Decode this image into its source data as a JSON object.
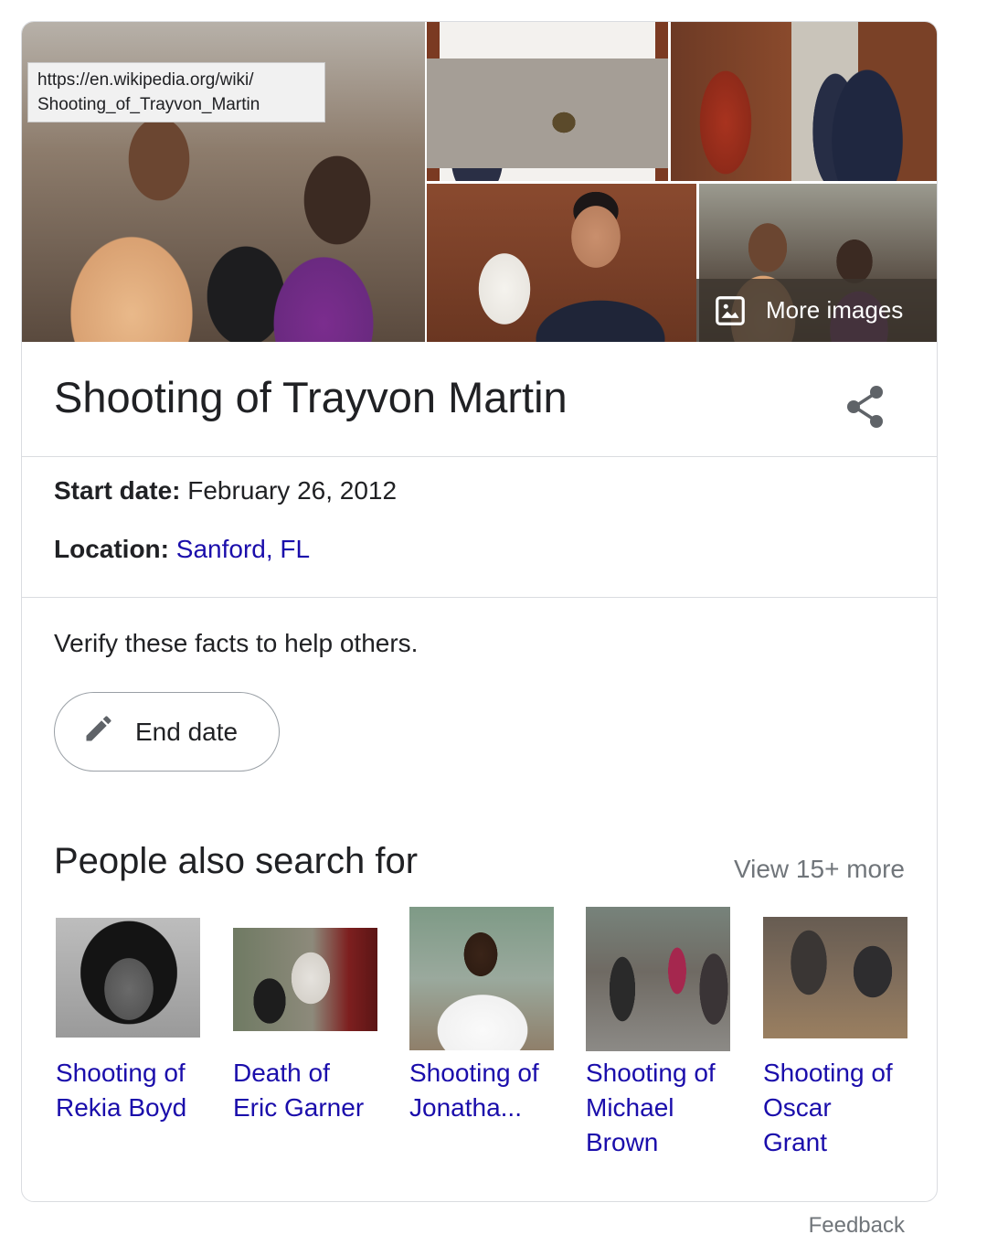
{
  "tooltip": {
    "line1": "https://en.wikipedia.org/wiki/",
    "line2": "Shooting_of_Trayvon_Martin"
  },
  "images": {
    "more_images_label": "More images"
  },
  "header": {
    "title": "Shooting of Trayvon Martin",
    "share_icon": "share-icon"
  },
  "facts": [
    {
      "label": "Start date:",
      "value": "February 26, 2012",
      "is_link": false
    },
    {
      "label": "Location:",
      "value": "Sanford, FL",
      "is_link": true
    }
  ],
  "verify": {
    "text": "Verify these facts to help others.",
    "button_label": "End date",
    "button_icon": "pencil-icon"
  },
  "people_also_search": {
    "title": "People also search for",
    "view_more": "View 15+ more",
    "items": [
      {
        "line1": "Shooting of",
        "line2": "Rekia Boyd",
        "line3": ""
      },
      {
        "line1": "Death of",
        "line2": "Eric Garner",
        "line3": ""
      },
      {
        "line1": "Shooting of",
        "line2": "Jonatha...",
        "line3": ""
      },
      {
        "line1": "Shooting of",
        "line2": "Michael",
        "line3": "Brown"
      },
      {
        "line1": "Shooting of",
        "line2": "Oscar",
        "line3": "Grant"
      }
    ]
  },
  "footer": {
    "feedback": "Feedback"
  },
  "colors": {
    "link": "#1a0dab",
    "text": "#202124",
    "muted": "#70757a",
    "border": "#dadce0"
  }
}
